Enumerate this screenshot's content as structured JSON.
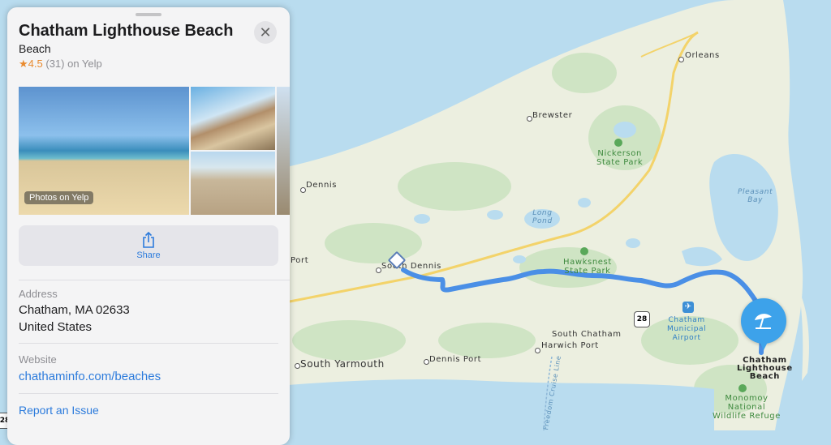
{
  "place": {
    "name": "Chatham Lighthouse Beach",
    "category": "Beach",
    "rating_star": "★",
    "rating_value": "4.5",
    "rating_rest": "(31) on Yelp"
  },
  "photos": {
    "badge": "Photos on Yelp"
  },
  "actions": {
    "share_label": "Share"
  },
  "address": {
    "label": "Address",
    "line1": "Chatham, MA 02633",
    "line2": "United States"
  },
  "website": {
    "label": "Website",
    "url": "chathaminfo.com/beaches"
  },
  "report_issue": "Report an Issue",
  "map": {
    "places": {
      "orleans": "Orleans",
      "brewster": "Brewster",
      "dennis": "Dennis",
      "south_dennis": "South Dennis",
      "port": "Port",
      "south_chatham": "South Chatham",
      "harwich_port": "Harwich Port",
      "dennis_port": "Dennis Port",
      "south_yarmouth": "South Yarmouth"
    },
    "parks": {
      "nickerson_1": "Nickerson",
      "nickerson_2": "State Park",
      "hawksnest_1": "Hawksnest",
      "hawksnest_2": "State Park",
      "monomoy_1": "Monomoy",
      "monomoy_2": "National",
      "monomoy_3": "Wildlife Refuge"
    },
    "water": {
      "pleasant_bay_1": "Pleasant",
      "pleasant_bay_2": "Bay",
      "long_pond_1": "Long",
      "long_pond_2": "Pond"
    },
    "airport": {
      "l1": "Chatham",
      "l2": "Municipal",
      "l3": "Airport"
    },
    "destination": {
      "l1": "Chatham",
      "l2": "Lighthouse",
      "l3": "Beach"
    },
    "route_shield": "28",
    "ferry_line": "Freedom Cruise Line",
    "edge_shield": "28",
    "route_color": "#4a8fe6",
    "destination_color": "#3da2ea"
  }
}
